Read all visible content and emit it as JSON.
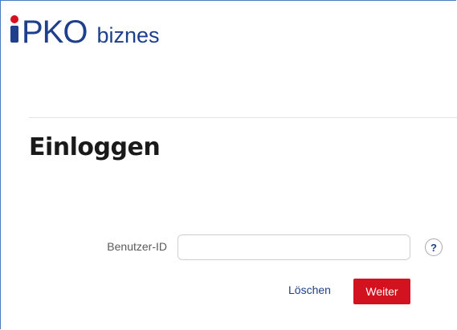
{
  "brand": {
    "logo_main": "PKO",
    "logo_sub": "biznes",
    "colors": {
      "brand_blue": "#1e3f8c",
      "brand_red": "#d3121f"
    }
  },
  "page": {
    "title": "Einloggen"
  },
  "login_form": {
    "user_id_label": "Benutzer-ID",
    "user_id_value": "",
    "help_icon": "?",
    "clear_label": "Löschen",
    "next_label": "Weiter"
  }
}
